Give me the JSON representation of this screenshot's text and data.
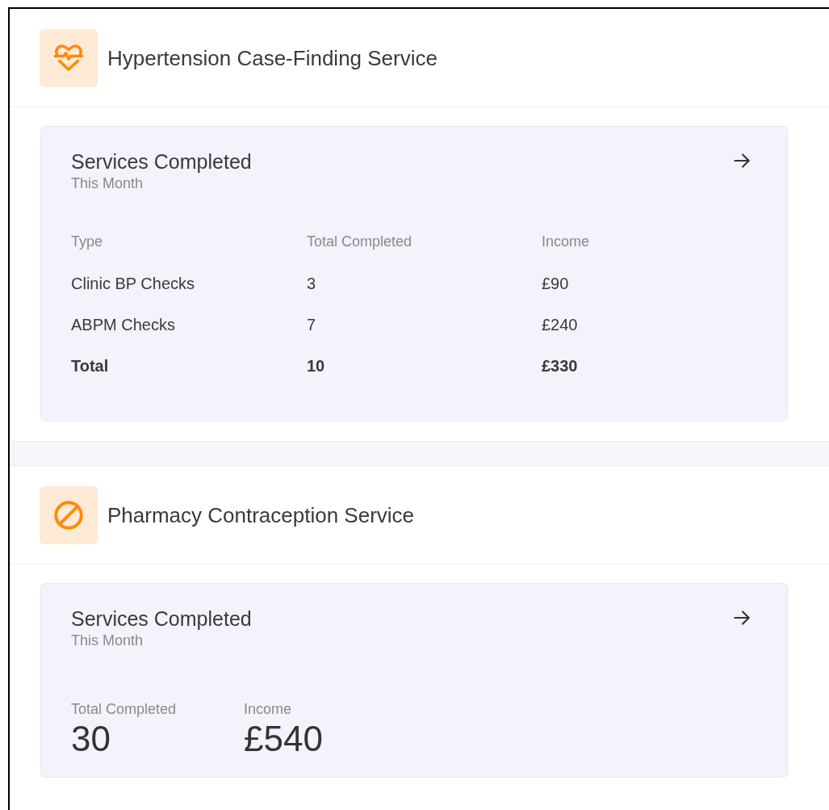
{
  "services": [
    {
      "title": "Hypertension Case-Finding Service",
      "card": {
        "kind": "table",
        "title": "Services Completed",
        "subtitle": "This Month",
        "columns": [
          "Type",
          "Total Completed",
          "Income"
        ],
        "rows": [
          {
            "kind": "item",
            "cells": [
              "Clinic BP Checks",
              "3",
              "£90"
            ]
          },
          {
            "kind": "item",
            "cells": [
              "ABPM Checks",
              "7",
              "£240"
            ]
          },
          {
            "kind": "total",
            "cells": [
              "Total",
              "10",
              "£330"
            ]
          }
        ]
      }
    },
    {
      "title": "Pharmacy Contraception Service",
      "card": {
        "kind": "stats",
        "title": "Services Completed",
        "subtitle": "This Month",
        "stats": [
          {
            "label": "Total Completed",
            "value": "30"
          },
          {
            "label": "Income",
            "value": "£540"
          }
        ]
      }
    }
  ]
}
